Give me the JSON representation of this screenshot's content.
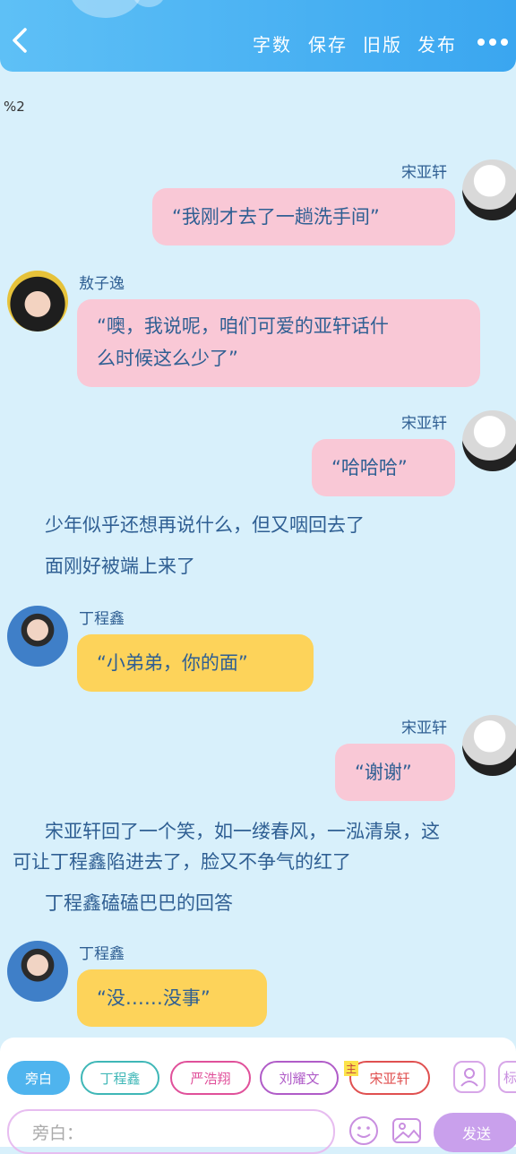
{
  "header": {
    "back_label": "<",
    "word_count": "字数",
    "save": "保存",
    "old_version": "旧版",
    "publish": "发布"
  },
  "chapter_marker": "%2",
  "messages": [
    {
      "type": "right",
      "name": "宋亚轩",
      "text": "“我刚才去了一趟洗手间”",
      "color": "#f9c8d6"
    },
    {
      "type": "left",
      "name": "敖子逸",
      "text_line1": "“噢，我说呢，咱们可爱的亚轩话什",
      "text_line2": "么时候这么少了”",
      "color": "#f9c8d6"
    },
    {
      "type": "right",
      "name": "宋亚轩",
      "text": "“哈哈哈”",
      "color": "#f9c8d6"
    },
    {
      "type": "narration",
      "line1": "少年似乎还想再说什么，但又咽回去了",
      "line2": "面刚好被端上来了"
    },
    {
      "type": "left",
      "name": "丁程鑫",
      "text": "“小弟弟，你的面”",
      "color": "#fdd35a"
    },
    {
      "type": "right",
      "name": "宋亚轩",
      "text": "“谢谢”",
      "color": "#f9c8d6"
    },
    {
      "type": "narration",
      "line1": "宋亚轩回了一个笑，如一缕春风，一泓清泉，这",
      "line2": "可让丁程鑫陷进去了，脸又不争气的红了",
      "line3": "丁程鑫磕磕巴巴的回答"
    },
    {
      "type": "left",
      "name": "丁程鑫",
      "text": "“没……没事”",
      "color": "#fdd35a"
    }
  ],
  "roles": [
    {
      "label": "旁白",
      "active": true,
      "color": "#4fb4ee"
    },
    {
      "label": "丁程鑫",
      "color": "#3fb7b7"
    },
    {
      "label": "严浩翔",
      "color": "#e0509a"
    },
    {
      "label": "刘耀文",
      "color": "#b05cc8"
    },
    {
      "label": "宋亚轩",
      "color": "#e05050",
      "main_badge": "主"
    }
  ],
  "extra_tab_label": "标",
  "input": {
    "placeholder": "旁白："
  },
  "send_label": "发送"
}
